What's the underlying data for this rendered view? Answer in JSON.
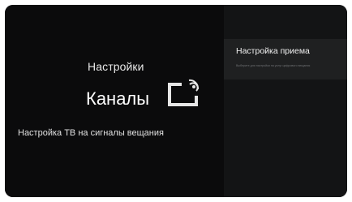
{
  "settings": {
    "category_label": "Настройки",
    "section_title": "Каналы",
    "section_icon": "broadcast-screen-icon",
    "section_description": "Настройка ТВ на сигналы вещания"
  },
  "menu": {
    "items": [
      {
        "label": "Настройка приема",
        "subtitle": "Выберите для настройки на услуг цифрового вещания",
        "selected": true
      }
    ]
  },
  "colors": {
    "background": "#0b0b0c",
    "panel": "#131415",
    "selected_item": "#1f2021",
    "icon": "#e6e6e6"
  }
}
